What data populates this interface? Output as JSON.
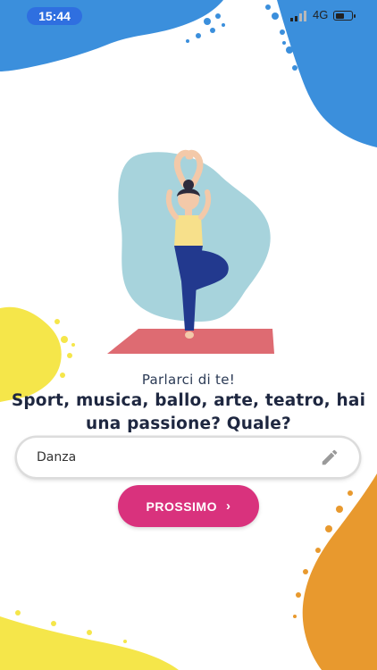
{
  "status_bar": {
    "time": "15:44",
    "network": "4G",
    "battery_level": 0.6
  },
  "illustration": {
    "icon": "yoga-woman-tree-pose"
  },
  "content": {
    "subtitle": "Parlarci di te!",
    "question": "Sport, musica, ballo, arte, teatro, hai una passione? Quale?"
  },
  "answer_field": {
    "value": "Danza",
    "icon": "pencil-icon"
  },
  "next_button": {
    "label": "PROSSIMO",
    "icon": "chevron-right-icon"
  },
  "colors": {
    "accent": "#d9327d",
    "blue": "#3b8fdc",
    "yellow": "#f5e64a",
    "orange": "#e8992e",
    "illustration_bg": "#a7d3dc",
    "mat": "#de6b72"
  }
}
